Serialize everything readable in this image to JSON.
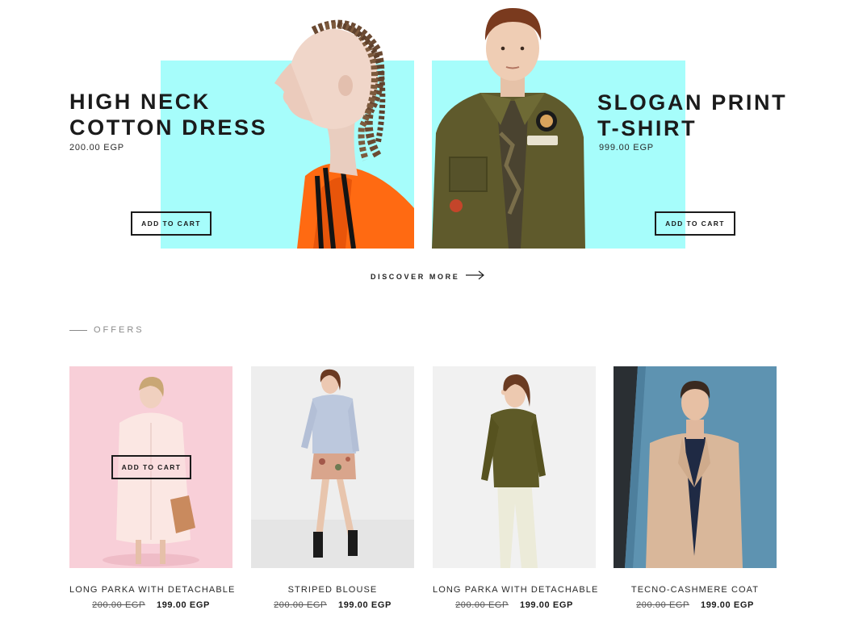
{
  "hero": [
    {
      "title_line1": "HIGH NECK",
      "title_line2": "COTTON DRESS",
      "price": "200.00 EGP",
      "cta": "ADD TO CART"
    },
    {
      "title_line1": "SLOGAN PRINT",
      "title_line2": "T-SHIRT",
      "price": "999.00 EGP",
      "cta": "ADD TO CART"
    }
  ],
  "discover": {
    "label": "DISCOVER MORE",
    "icon": "arrow-right-icon"
  },
  "offers": {
    "heading": "OFFERS",
    "hover_cta": "ADD TO CART",
    "products": [
      {
        "name": "LONG PARKA WITH DETACHABLE",
        "old_price": "200.00 EGP",
        "new_price": "199.00 EGP"
      },
      {
        "name": "STRIPED BLOUSE",
        "old_price": "200.00 EGP",
        "new_price": "199.00 EGP"
      },
      {
        "name": "LONG PARKA WITH DETACHABLE",
        "old_price": "200.00 EGP",
        "new_price": "199.00 EGP"
      },
      {
        "name": "TECNO-CASHMERE COAT",
        "old_price": "200.00 EGP",
        "new_price": "199.00 EGP"
      }
    ]
  },
  "colors": {
    "accent_cyan": "#a6fdfb",
    "text": "#1b1b1b",
    "muted": "#8a8a8a"
  }
}
